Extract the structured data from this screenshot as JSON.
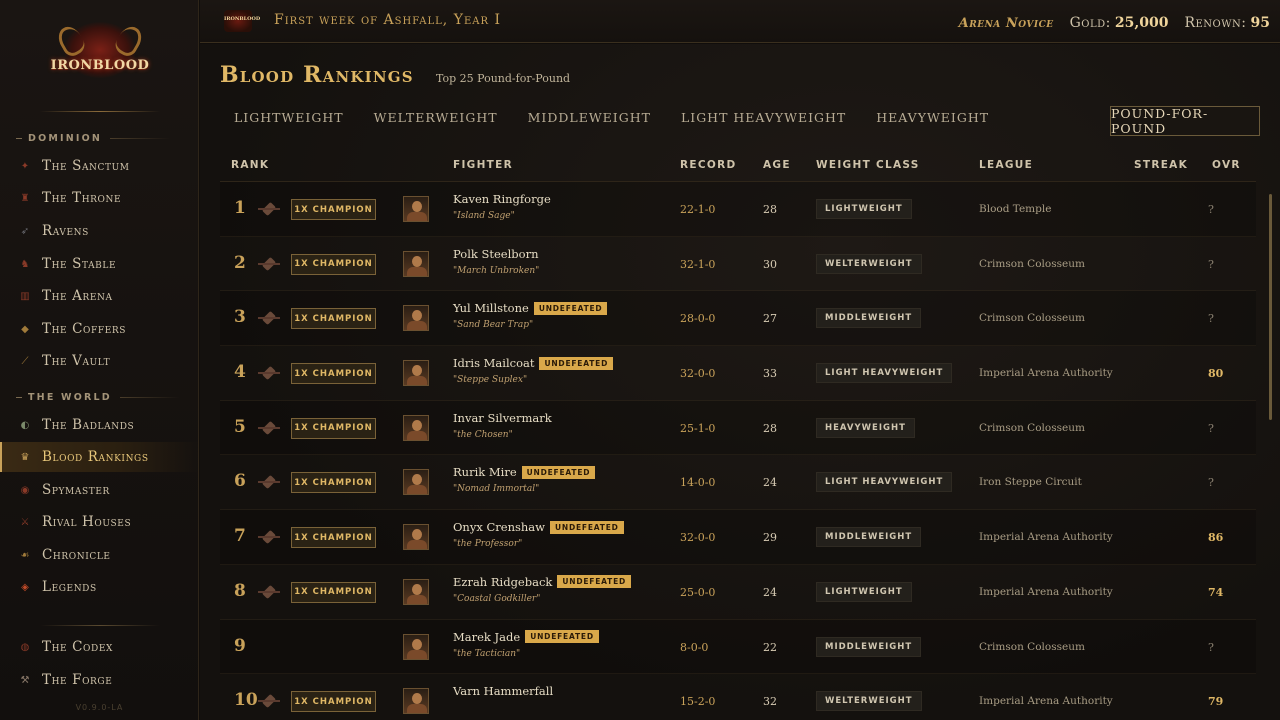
{
  "app": {
    "logo_text": "IRONBLOOD",
    "version": "V0.9.0-LA",
    "accent": "#e0b866"
  },
  "topbar": {
    "date": "First week of Ashfall, Year I",
    "rank_title": "Arena Novice",
    "gold_label": "Gold:",
    "gold_value": "25,000",
    "renown_label": "Renown:",
    "renown_value": "95"
  },
  "sidebar": {
    "section_dominion": "DOMINION",
    "section_world": "THE WORLD",
    "items": [
      {
        "label": "The Sanctum",
        "icon": "sanctum-icon"
      },
      {
        "label": "The Throne",
        "icon": "throne-icon"
      },
      {
        "label": "Ravens",
        "icon": "raven-icon"
      },
      {
        "label": "The Stable",
        "icon": "stable-icon"
      },
      {
        "label": "The Arena",
        "icon": "arena-icon"
      },
      {
        "label": "The Coffers",
        "icon": "coffers-icon"
      },
      {
        "label": "The Vault",
        "icon": "vault-icon"
      },
      {
        "label": "The Badlands",
        "icon": "badlands-icon"
      },
      {
        "label": "Blood Rankings",
        "icon": "trophy-icon"
      },
      {
        "label": "Spymaster",
        "icon": "eye-icon"
      },
      {
        "label": "Rival Houses",
        "icon": "house-icon"
      },
      {
        "label": "Chronicle",
        "icon": "book-icon"
      },
      {
        "label": "Legends",
        "icon": "legend-icon"
      },
      {
        "label": "The Codex",
        "icon": "codex-icon"
      },
      {
        "label": "The Forge",
        "icon": "forge-icon"
      }
    ]
  },
  "page": {
    "title": "Blood Rankings",
    "subtitle": "Top 25 Pound-for-Pound",
    "tabs": [
      "LIGHTWEIGHT",
      "WELTERWEIGHT",
      "MIDDLEWEIGHT",
      "LIGHT HEAVYWEIGHT",
      "HEAVYWEIGHT"
    ],
    "active_tab": "POUND-FOR-POUND"
  },
  "table": {
    "headers": {
      "rank": "RANK",
      "fighter": "FIGHTER",
      "record": "RECORD",
      "age": "AGE",
      "weight": "WEIGHT CLASS",
      "league": "LEAGUE",
      "streak": "STREAK",
      "ovr": "OVR"
    },
    "rows": [
      {
        "rank": "1",
        "champion": "1X CHAMPION",
        "name": "Kaven Ringforge",
        "badge": "",
        "nick": "\"Island Sage\"",
        "record": "22-1-0",
        "age": "28",
        "weight": "LIGHTWEIGHT",
        "league": "Blood Temple",
        "ovr": "?"
      },
      {
        "rank": "2",
        "champion": "1X CHAMPION",
        "name": "Polk Steelborn",
        "badge": "",
        "nick": "\"March Unbroken\"",
        "record": "32-1-0",
        "age": "30",
        "weight": "WELTERWEIGHT",
        "league": "Crimson Colosseum",
        "ovr": "?"
      },
      {
        "rank": "3",
        "champion": "1X CHAMPION",
        "name": "Yul Millstone",
        "badge": "UNDEFEATED",
        "nick": "\"Sand Bear Trap\"",
        "record": "28-0-0",
        "age": "27",
        "weight": "MIDDLEWEIGHT",
        "league": "Crimson Colosseum",
        "ovr": "?"
      },
      {
        "rank": "4",
        "champion": "1X CHAMPION",
        "name": "Idris Mailcoat",
        "badge": "UNDEFEATED",
        "nick": "\"Steppe Suplex\"",
        "record": "32-0-0",
        "age": "33",
        "weight": "LIGHT HEAVYWEIGHT",
        "league": "Imperial Arena Authority",
        "ovr": "80"
      },
      {
        "rank": "5",
        "champion": "1X CHAMPION",
        "name": "Invar Silvermark",
        "badge": "",
        "nick": "\"the Chosen\"",
        "record": "25-1-0",
        "age": "28",
        "weight": "HEAVYWEIGHT",
        "league": "Crimson Colosseum",
        "ovr": "?"
      },
      {
        "rank": "6",
        "champion": "1X CHAMPION",
        "name": "Rurik Mire",
        "badge": "UNDEFEATED",
        "nick": "\"Nomad Immortal\"",
        "record": "14-0-0",
        "age": "24",
        "weight": "LIGHT HEAVYWEIGHT",
        "league": "Iron Steppe Circuit",
        "ovr": "?"
      },
      {
        "rank": "7",
        "champion": "1X CHAMPION",
        "name": "Onyx Crenshaw",
        "badge": "UNDEFEATED",
        "nick": "\"the Professor\"",
        "record": "32-0-0",
        "age": "29",
        "weight": "MIDDLEWEIGHT",
        "league": "Imperial Arena Authority",
        "ovr": "86"
      },
      {
        "rank": "8",
        "champion": "1X CHAMPION",
        "name": "Ezrah Ridgeback",
        "badge": "UNDEFEATED",
        "nick": "\"Coastal Godkiller\"",
        "record": "25-0-0",
        "age": "24",
        "weight": "LIGHTWEIGHT",
        "league": "Imperial Arena Authority",
        "ovr": "74"
      },
      {
        "rank": "9",
        "champion": "",
        "name": "Marek Jade",
        "badge": "UNDEFEATED",
        "nick": "\"the Tactician\"",
        "record": "8-0-0",
        "age": "22",
        "weight": "MIDDLEWEIGHT",
        "league": "Crimson Colosseum",
        "ovr": "?"
      },
      {
        "rank": "10",
        "champion": "1X CHAMPION",
        "name": "Varn Hammerfall",
        "badge": "",
        "nick": "",
        "record": "15-2-0",
        "age": "32",
        "weight": "WELTERWEIGHT",
        "league": "Imperial Arena Authority",
        "ovr": "79"
      }
    ]
  }
}
